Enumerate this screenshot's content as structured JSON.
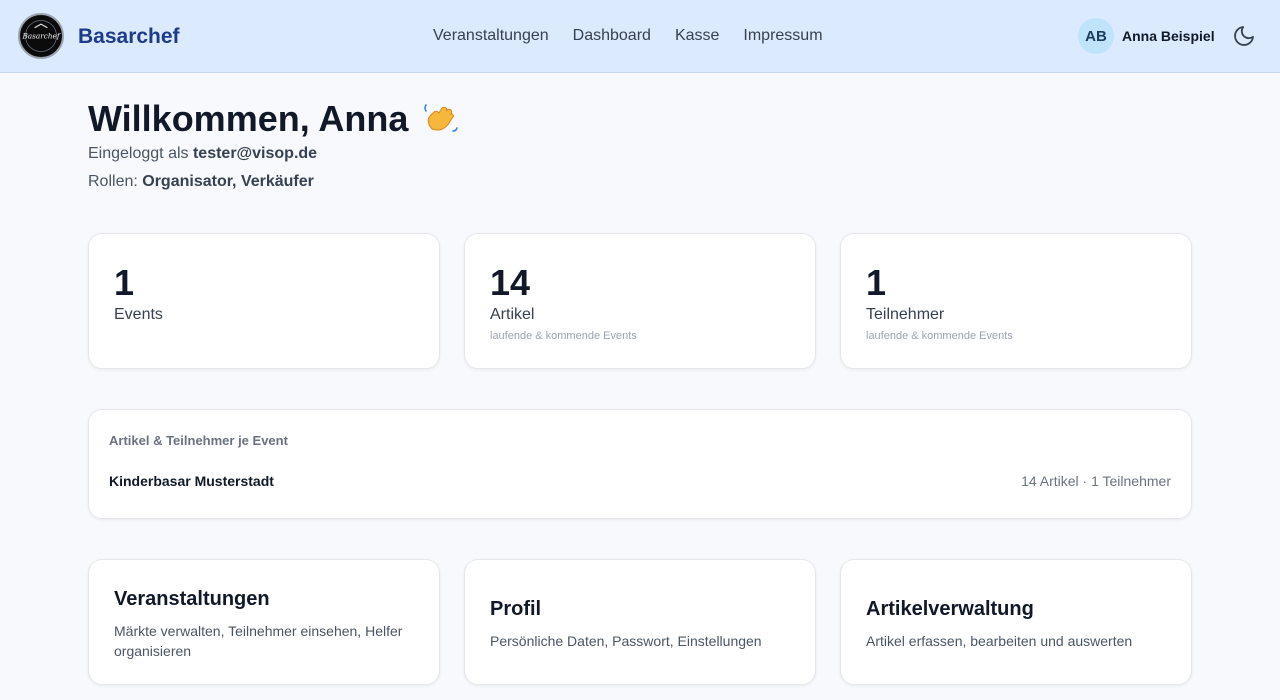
{
  "header": {
    "brand": "Basarchef",
    "logo_text": "Basarchef",
    "nav": [
      "Veranstaltungen",
      "Dashboard",
      "Kasse",
      "Impressum"
    ],
    "user_initials": "AB",
    "user_name": "Anna Beispiel"
  },
  "welcome": {
    "title": "Willkommen, Anna",
    "logged_in_prefix": "Eingeloggt als ",
    "email": "tester@visop.de",
    "roles_prefix": "Rollen: ",
    "roles": "Organisator, Verkäufer"
  },
  "stats": [
    {
      "value": "1",
      "label": "Events",
      "sub": ""
    },
    {
      "value": "14",
      "label": "Artikel",
      "sub": "laufende & kommende Events"
    },
    {
      "value": "1",
      "label": "Teilnehmer",
      "sub": "laufende & kommende Events"
    }
  ],
  "events_panel": {
    "title": "Artikel & Teilnehmer je Event",
    "rows": [
      {
        "name": "Kinderbasar Musterstadt",
        "stats": "14 Artikel · 1 Teilnehmer"
      }
    ]
  },
  "actions": [
    {
      "title": "Veranstaltungen",
      "desc": "Märkte verwalten, Teilnehmer einsehen, Helfer organisieren"
    },
    {
      "title": "Profil",
      "desc": "Persönliche Daten, Passwort, Einstellungen"
    },
    {
      "title": "Artikelverwaltung",
      "desc": "Artikel erfassen, bearbeiten und auswerten"
    }
  ],
  "colors": {
    "header_bg": "#dbeafe",
    "brand": "#1e3a8a",
    "avatar_bg": "#bfe3fb",
    "page_bg": "#f7f9fc"
  },
  "icons": [
    "logo",
    "wave-icon",
    "moon-icon"
  ]
}
